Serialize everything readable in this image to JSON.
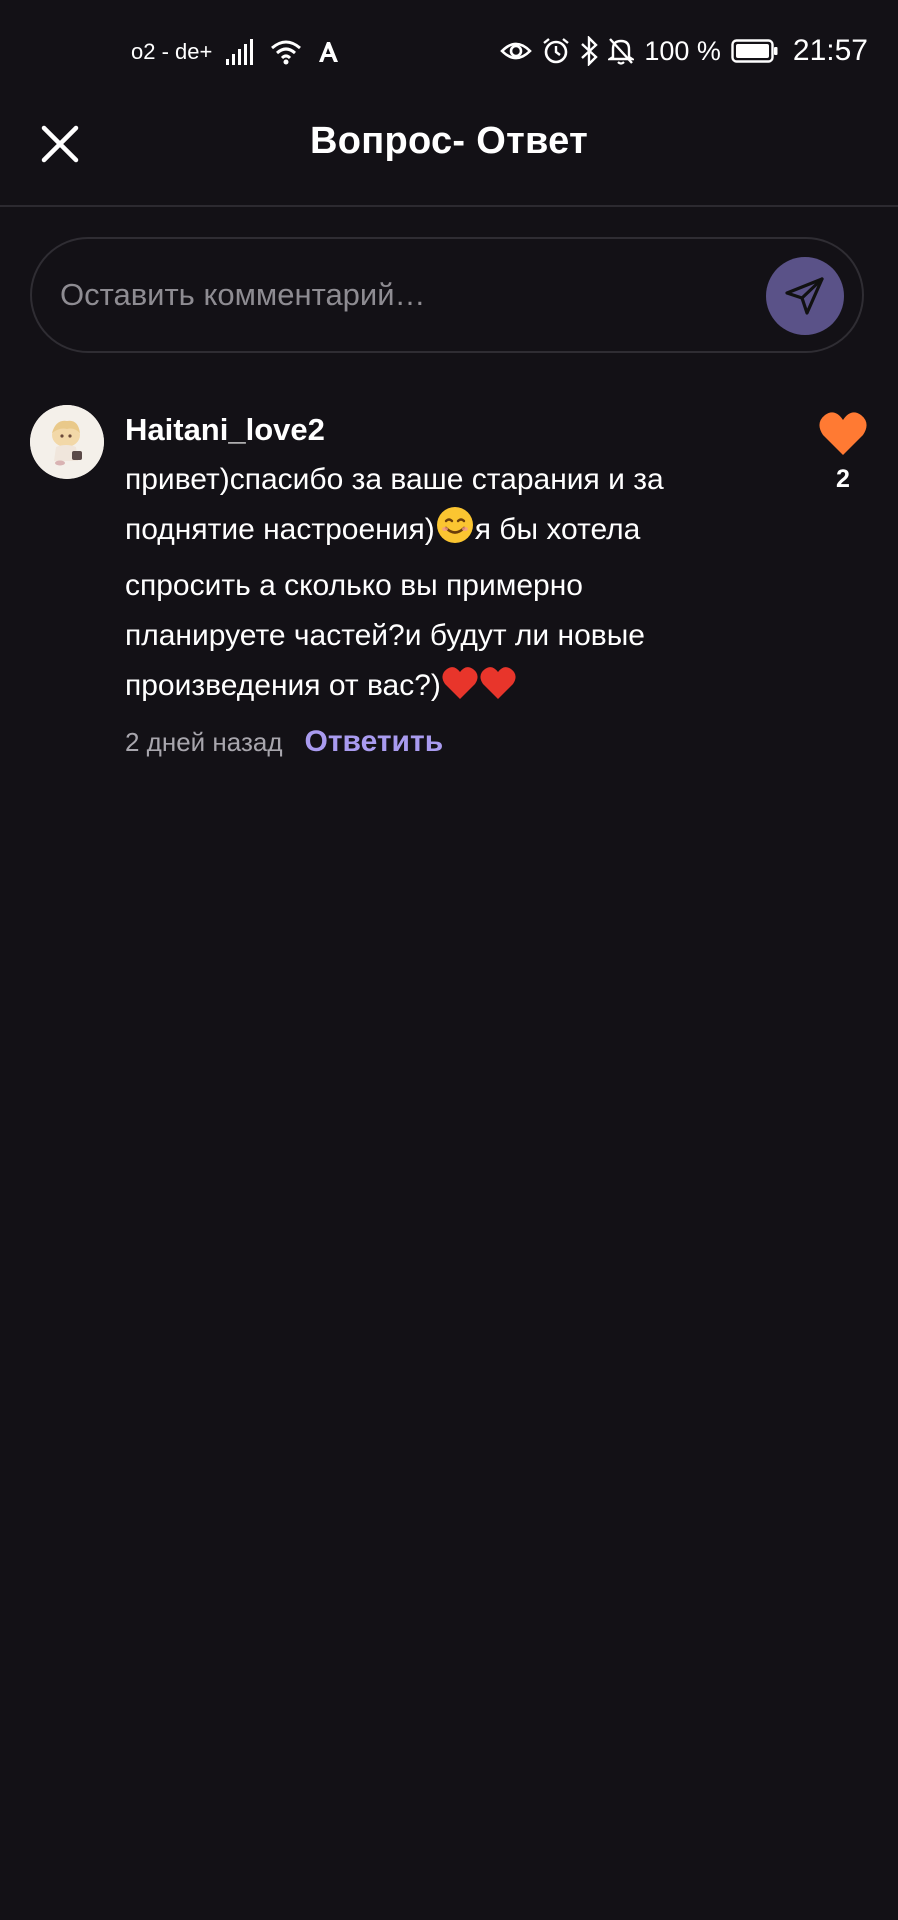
{
  "status_bar": {
    "carrier": "o2 - de+",
    "battery": "100 %",
    "time": "21:57"
  },
  "header": {
    "title": "Вопрос- Ответ"
  },
  "comment_input": {
    "placeholder": "Оставить комментарий…"
  },
  "comment": {
    "username": "Haitani_love2",
    "text_part1": "привет)спасибо за ваше старания и за поднятие настроения)",
    "text_part2": "я бы хотела спросить а сколько вы примерно планируете частей?и будут ли новые произведения от вас?)",
    "time_ago": "2 дней назад",
    "reply_label": "Ответить",
    "likes": "2"
  },
  "colors": {
    "background": "#131116",
    "accent": "#a99bef",
    "send_button": "#5a5288",
    "like_heart": "#ff7a33"
  }
}
